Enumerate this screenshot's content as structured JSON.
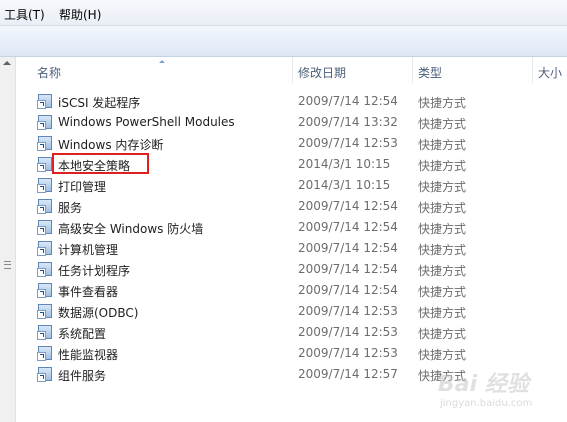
{
  "menu": {
    "items": [
      "工具(T)",
      "帮助(H)"
    ]
  },
  "columns": {
    "name": "名称",
    "modified": "修改日期",
    "type": "类型",
    "size": "大小"
  },
  "files": [
    {
      "name": "iSCSI 发起程序",
      "date": "2009/7/14 12:54",
      "type": "快捷方式"
    },
    {
      "name": "Windows PowerShell Modules",
      "date": "2009/7/14 13:32",
      "type": "快捷方式"
    },
    {
      "name": "Windows 内存诊断",
      "date": "2009/7/14 12:53",
      "type": "快捷方式"
    },
    {
      "name": "本地安全策略",
      "date": "2014/3/1 10:15",
      "type": "快捷方式"
    },
    {
      "name": "打印管理",
      "date": "2014/3/1 10:15",
      "type": "快捷方式"
    },
    {
      "name": "服务",
      "date": "2009/7/14 12:54",
      "type": "快捷方式"
    },
    {
      "name": "高级安全 Windows 防火墙",
      "date": "2009/7/14 12:54",
      "type": "快捷方式"
    },
    {
      "name": "计算机管理",
      "date": "2009/7/14 12:54",
      "type": "快捷方式"
    },
    {
      "name": "任务计划程序",
      "date": "2009/7/14 12:54",
      "type": "快捷方式"
    },
    {
      "name": "事件查看器",
      "date": "2009/7/14 12:54",
      "type": "快捷方式"
    },
    {
      "name": "数据源(ODBC)",
      "date": "2009/7/14 12:53",
      "type": "快捷方式"
    },
    {
      "name": "系统配置",
      "date": "2009/7/14 12:53",
      "type": "快捷方式"
    },
    {
      "name": "性能监视器",
      "date": "2009/7/14 12:53",
      "type": "快捷方式"
    },
    {
      "name": "组件服务",
      "date": "2009/7/14 12:57",
      "type": "快捷方式"
    }
  ],
  "watermark": {
    "text": "Bai 经验",
    "url": "jingyan.baidu.com"
  }
}
